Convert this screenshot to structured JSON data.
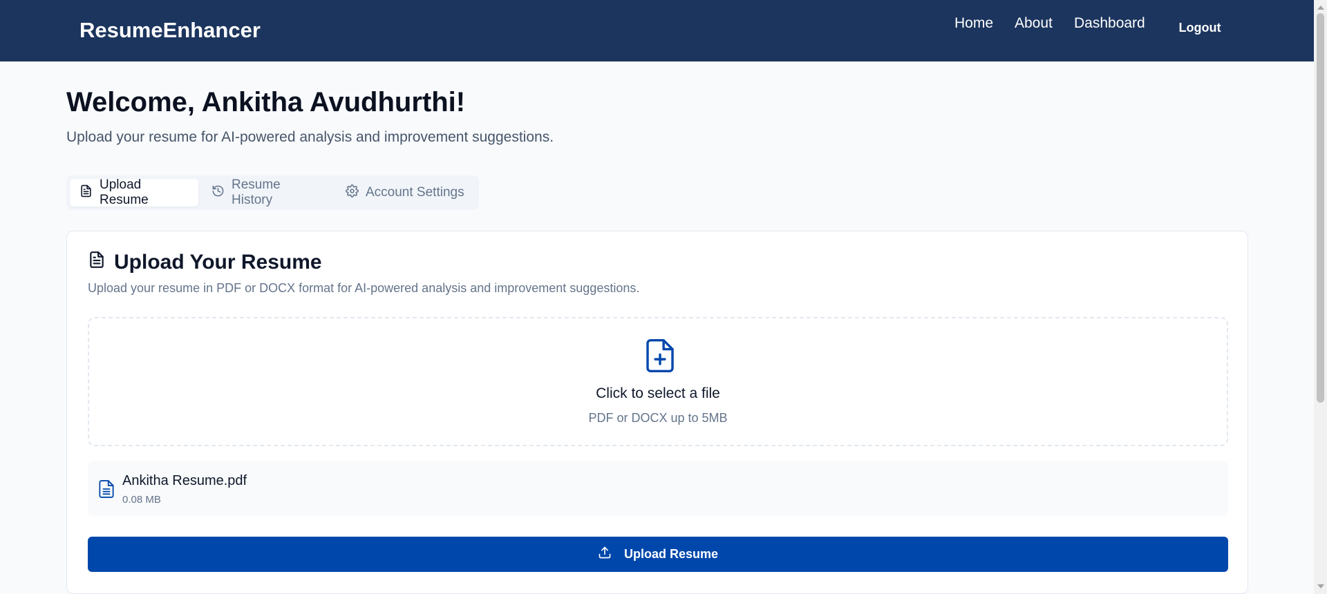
{
  "header": {
    "brand": "ResumeEnhancer",
    "nav": {
      "home": "Home",
      "about": "About",
      "dashboard": "Dashboard"
    },
    "logout": "Logout"
  },
  "welcome": {
    "title": "Welcome, Ankitha Avudhurthi!",
    "subtitle": "Upload your resume for AI-powered analysis and improvement suggestions."
  },
  "tabs": [
    {
      "label": "Upload Resume",
      "icon": "file-text-icon",
      "active": true
    },
    {
      "label": "Resume History",
      "icon": "history-icon",
      "active": false
    },
    {
      "label": "Account Settings",
      "icon": "gear-icon",
      "active": false
    }
  ],
  "upload_card": {
    "title": "Upload Your Resume",
    "description": "Upload your resume in PDF or DOCX format for AI-powered analysis and improvement suggestions.",
    "dropzone": {
      "title": "Click to select a file",
      "hint": "PDF or DOCX up to 5MB",
      "icon": "file-plus-icon"
    },
    "selected_file": {
      "name": "Ankitha Resume.pdf",
      "size": "0.08 MB",
      "icon": "file-text-icon"
    },
    "button_label": "Upload Resume",
    "button_icon": "upload-icon"
  },
  "colors": {
    "navbar": "#1c355e",
    "primary": "#0047ab",
    "background": "#f8fafc"
  }
}
